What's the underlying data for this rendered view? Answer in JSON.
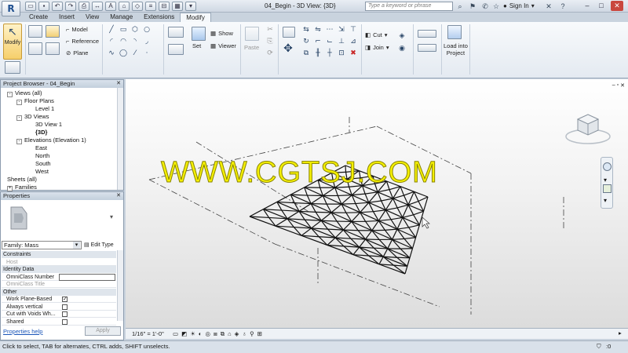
{
  "titlebar": {
    "document_title": "04_Begin - 3D View: {3D}",
    "search_placeholder": "Type a keyword or phrase",
    "signin_label": "Sign In",
    "app_letter": "R"
  },
  "tabs": [
    {
      "label": "Create"
    },
    {
      "label": "Insert"
    },
    {
      "label": "View"
    },
    {
      "label": "Manage"
    },
    {
      "label": "Extensions"
    },
    {
      "label": "Modify"
    }
  ],
  "ribbon": {
    "modify_label": "Modify",
    "model_label": "Model",
    "reference_label": "Reference",
    "plane_label": "Plane",
    "set_label": "Set",
    "show_label": "Show",
    "viewer_label": "Viewer",
    "paste_label": "Paste",
    "cut_label": "Cut",
    "join_label": "Join",
    "load_label_1": "Load into",
    "load_label_2": "Project"
  },
  "project_browser": {
    "title": "Project Browser - 04_Begin",
    "items": [
      {
        "label": "Views (all)",
        "level": 0,
        "expander": "-"
      },
      {
        "label": "Floor Plans",
        "level": 1,
        "expander": "-"
      },
      {
        "label": "Level 1",
        "level": 3,
        "expander": ""
      },
      {
        "label": "3D Views",
        "level": 1,
        "expander": "-"
      },
      {
        "label": "3D View 1",
        "level": 3,
        "expander": ""
      },
      {
        "label": "{3D}",
        "level": 3,
        "expander": "",
        "bold": true
      },
      {
        "label": "Elevations (Elevation 1)",
        "level": 1,
        "expander": "-"
      },
      {
        "label": "East",
        "level": 3,
        "expander": ""
      },
      {
        "label": "North",
        "level": 3,
        "expander": ""
      },
      {
        "label": "South",
        "level": 3,
        "expander": ""
      },
      {
        "label": "West",
        "level": 3,
        "expander": ""
      },
      {
        "label": "Sheets (all)",
        "level": 0,
        "expander": ""
      },
      {
        "label": "Families",
        "level": 0,
        "expander": "+"
      }
    ]
  },
  "properties": {
    "title": "Properties",
    "family_selector": "Family: Mass",
    "edit_type_label": "Edit Type",
    "rows": [
      {
        "kind": "cat",
        "label": "Constraints"
      },
      {
        "kind": "row",
        "label": "Host",
        "dim": true
      },
      {
        "kind": "cat",
        "label": "Identity Data"
      },
      {
        "kind": "row",
        "label": "OmniClass Number",
        "box": true
      },
      {
        "kind": "row",
        "label": "OmniClass Title",
        "dim": true
      },
      {
        "kind": "cat",
        "label": "Other"
      },
      {
        "kind": "row",
        "label": "Work Plane-Based",
        "check": "✓"
      },
      {
        "kind": "row",
        "label": "Always vertical",
        "check": " "
      },
      {
        "kind": "row",
        "label": "Cut with Voids Wh...",
        "check": " "
      },
      {
        "kind": "row",
        "label": "Shared",
        "check": " "
      }
    ],
    "help_link": "Properties help",
    "apply_label": "Apply"
  },
  "viewport": {
    "watermark": "WWW.CGTSJ.COM"
  },
  "viewbar": {
    "scale": "1/16\" = 1'-0\""
  },
  "statusbar": {
    "message": "Click to select, TAB for alternates, CTRL adds, SHIFT unselects.",
    "filter_count": ":0"
  },
  "colors": {
    "accent": "#f6cf6b",
    "watermark": "#f5f000",
    "close_button": "#c9473e"
  }
}
